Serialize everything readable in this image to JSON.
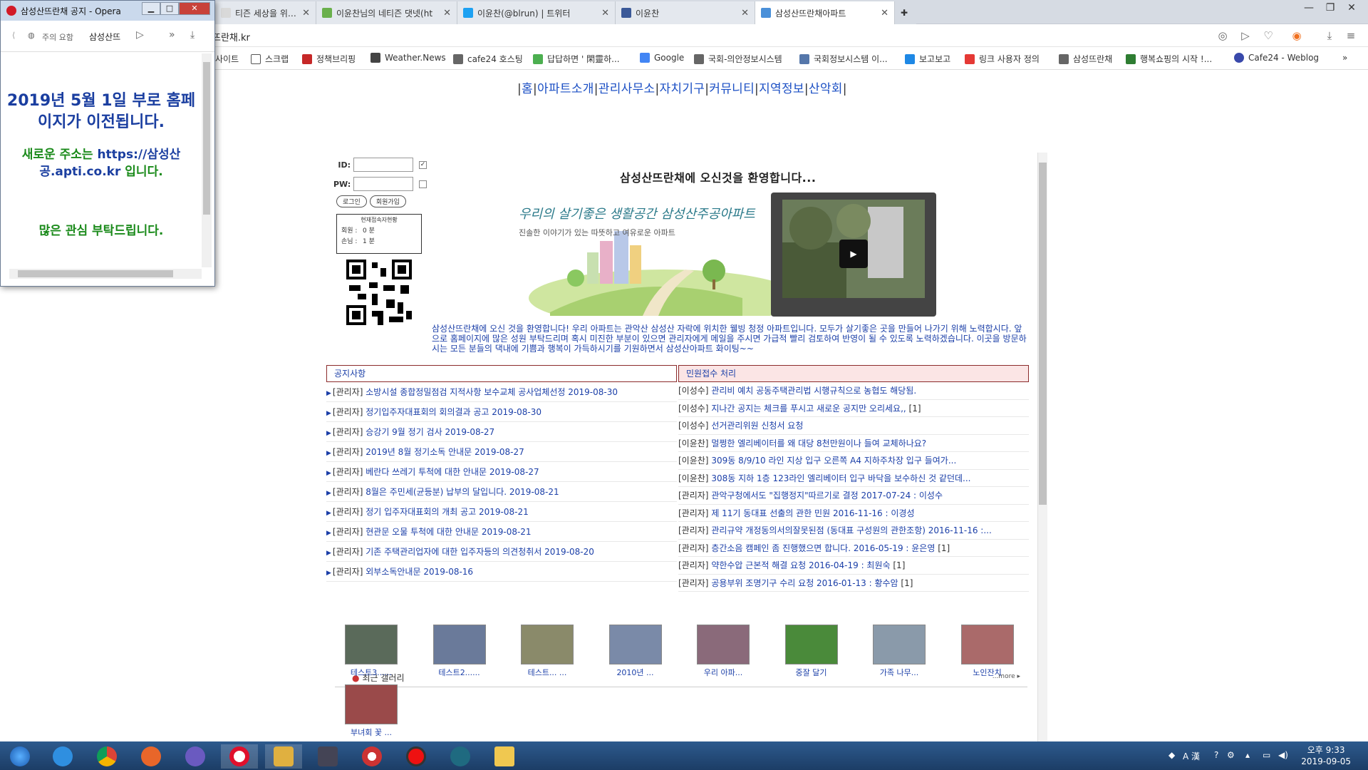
{
  "browser": {
    "tabs": [
      {
        "label": "티즌 세상을 위하여...",
        "color": "#d9d9d9"
      },
      {
        "label": "이윤찬님의 네티즌 댓넷(ht",
        "color": "#6ab04c"
      },
      {
        "label": "이윤찬(@blrun) | 트위터",
        "color": "#1da1f2"
      },
      {
        "label": "이윤찬",
        "color": "#3b5998"
      },
      {
        "label": "삼성산뜨란채아파트",
        "color": "#4a90d9"
      }
    ],
    "url": "뜨란채.kr",
    "bookmarks": [
      "사이트",
      "스크랩",
      "정책브리핑",
      "Weather.News",
      "cafe24 호스팅",
      "답답하면 ' 閑靈하...",
      "Google",
      "국회-의안정보시스템",
      "국회정보시스템 이...",
      "보고보고",
      "링크 사용자 정의",
      "삼성뜨란채",
      "행복쇼핑의 시작 !...",
      "Cafe24 - Weblog"
    ]
  },
  "popup": {
    "title": "삼성산뜨란채 공지 - Opera",
    "toolbar_summary": "주의 요함",
    "toolbar_text": "삼성산뜨",
    "line1": "2019년 5월 1일 부로 홈페이지가 이전됩니다.",
    "line2_a": "새로운 주소는 ",
    "line2_url": "https://삼성산공.apti.co.kr",
    "line2_b": " 입니다.",
    "line3": "많은 관심 부탁드립니다."
  },
  "site": {
    "nav": [
      "홈",
      "아파트소개",
      "관리사무소",
      "자치기구",
      "커뮤니티",
      "지역정보",
      "산악회"
    ],
    "login": {
      "id_label": "ID:",
      "pw_label": "PW:",
      "login_button": "로그인",
      "join_button": "회원가입",
      "counter_title": "현재접속자현황",
      "member_label": "회원 :",
      "member_value": "0 분",
      "guest_label": "손님 :",
      "guest_value": "1 분"
    },
    "welcome": "삼성산뜨란채에 오신것을 환영합니다...",
    "slogan": "우리의 살기좋은 생활공간 삼성산주공아파트",
    "subslogan": "진솔한 이야기가 있는 따뜻하고 여유로운 아파트",
    "intro": "삼성산뜨란채에 오신 것을 환영합니다! 우리 아파트는 관악산 삼성산 자락에 위치한 웰빙 청정 아파트입니다. 모두가 살기좋은 곳을 만들어 나가기 위해 노력합시다. 앞으로 홈페이지에 많은 성원 부탁드리며 혹시 미진한 부분이 있으면 관리자에게 메일을 주시면 가급적 빨리 검토하여 반영이 될 수 있도록 노력하겠습니다. 이곳을 방문하시는 모든 분들의 댁내에 기쁨과 행복이 가득하시기를 기원하면서 삼성산아파트 화이팅~~",
    "notice": {
      "title": "공지사항",
      "rows": [
        {
          "author": "[관리자]",
          "text": "소방시설 종합정밀점검 지적사항 보수교체 공사업체선정 2019-08-30"
        },
        {
          "author": "[관리자]",
          "text": "정기입주자대표회의 회의결과 공고 2019-08-30"
        },
        {
          "author": "[관리자]",
          "text": "승강기 9월 정기 검사 2019-08-27"
        },
        {
          "author": "[관리자]",
          "text": "2019년 8월 정기소독 안내문 2019-08-27"
        },
        {
          "author": "[관리자]",
          "text": "베란다 쓰레기 투척에 대한 안내문 2019-08-27"
        },
        {
          "author": "[관리자]",
          "text": "8월은 주민세(균등분) 납부의 달입니다. 2019-08-21"
        },
        {
          "author": "[관리자]",
          "text": "정기 입주자대표회의 개최 공고 2019-08-21"
        },
        {
          "author": "[관리자]",
          "text": "현관문 오물 투척에 대한 안내문 2019-08-21"
        },
        {
          "author": "[관리자]",
          "text": "기존 주택관리업자에 대한 입주자등의 의견청취서 2019-08-20"
        },
        {
          "author": "[관리자]",
          "text": "외부소독안내문 2019-08-16"
        }
      ]
    },
    "civil": {
      "title": "민원접수 처리",
      "rows": [
        {
          "author": "[이성수]",
          "text": "관리비 예치 공동주택관리법 시행규칙으로 농협도 해당됨.",
          "count": ""
        },
        {
          "author": "[이성수]",
          "text": "지나간 공지는 체크를 푸시고 새로운 공지만 오리세요,,",
          "count": "[1]"
        },
        {
          "author": "[이성수]",
          "text": "선거관리위원 신청서 요청",
          "count": ""
        },
        {
          "author": "[이윤찬]",
          "text": "멀쩡한 엘리베이터를 왜 대당 8천만원이나 들여 교체하나요?",
          "count": ""
        },
        {
          "author": "[이윤찬]",
          "text": "309동 8/9/10 라인 지상 입구 오른쪽 A4 지하주차장 입구 들여가...",
          "count": ""
        },
        {
          "author": "[이윤찬]",
          "text": "308동 지하 1층 123라인 엘리베이터 입구 바닥을 보수하신 것 같던데...",
          "count": ""
        },
        {
          "author": "[관리자]",
          "text": "관악구청에서도 \"집행정지\"따르기로 결정 2017-07-24 : 이성수",
          "count": ""
        },
        {
          "author": "[관리자]",
          "text": "제 11기 동대표 선출의 관한 민원 2016-11-16 : 이경성",
          "count": ""
        },
        {
          "author": "[관리자]",
          "text": "관리규약 개정동의서의잘못된점 (동대표 구성원의 관한조항) 2016-11-16 :...",
          "count": ""
        },
        {
          "author": "[관리자]",
          "text": "층간소음 캠페인 좀 진행했으면 합니다. 2016-05-19 : 윤은영",
          "count": "[1]"
        },
        {
          "author": "[관리자]",
          "text": "약한수압 근본적 해결 요청 2016-04-19 : 최원숙",
          "count": "[1]"
        },
        {
          "author": "[관리자]",
          "text": "공용부위 조명기구 수리 요청 2016-01-13 : 황수암",
          "count": "[1]"
        }
      ]
    },
    "gallery": {
      "title": "최근 갤러리",
      "more": "...more ▸",
      "items": [
        {
          "caption": "테스트3......",
          "color": "#5a6a5a"
        },
        {
          "caption": "테스트2......",
          "color": "#6a7a9a"
        },
        {
          "caption": "테스트... ...",
          "color": "#8a8a6a"
        },
        {
          "caption": "2010년 ...",
          "color": "#7a8aa8"
        },
        {
          "caption": "우리 아파...",
          "color": "#8a6a7a"
        },
        {
          "caption": "중잘 달기",
          "color": "#4a8a3a"
        },
        {
          "caption": "가족 나무...",
          "color": "#8a9aaa"
        },
        {
          "caption": "노인잔치",
          "color": "#aa6a6a"
        },
        {
          "caption": "부녀회 꽃 ...",
          "color": "#9a4a4a"
        }
      ]
    }
  },
  "taskbar": {
    "time": "오후 9:33",
    "date": "2019-09-05",
    "ime": "A 漢"
  }
}
